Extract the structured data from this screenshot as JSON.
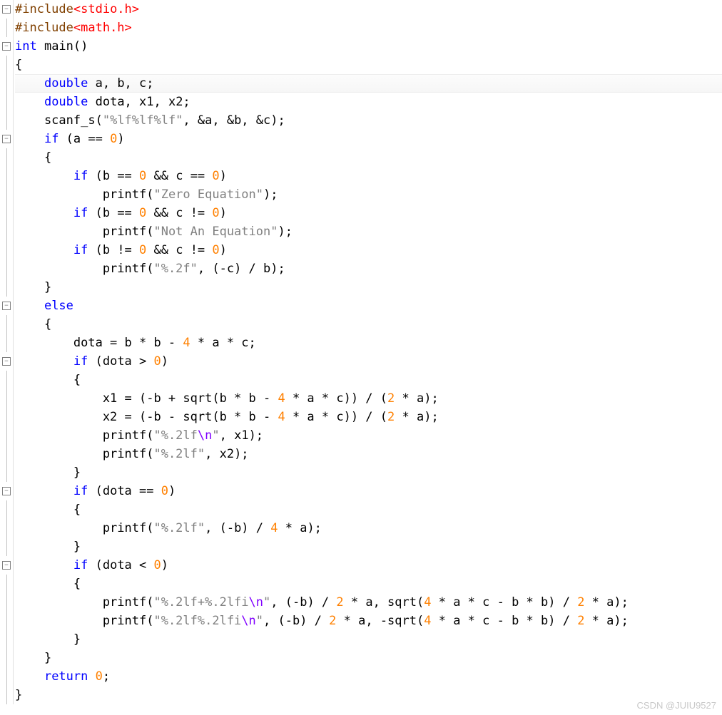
{
  "watermark": "CSDN @JUIU9527",
  "gutter": {
    "fold_minus": "⊟",
    "fold_line": "│"
  },
  "lines": [
    {
      "g": "box",
      "tokens": [
        {
          "t": "#include",
          "c": "preproc"
        },
        {
          "t": "<stdio.h>",
          "c": "angled"
        }
      ]
    },
    {
      "g": "line",
      "tokens": [
        {
          "t": "#include",
          "c": "preproc"
        },
        {
          "t": "<math.h>",
          "c": "angled"
        }
      ]
    },
    {
      "g": "box",
      "tokens": [
        {
          "t": "int",
          "c": "kw-blue"
        },
        {
          "t": " main()",
          "c": "func"
        }
      ]
    },
    {
      "g": "line",
      "tokens": [
        {
          "t": "{",
          "c": "func"
        }
      ]
    },
    {
      "g": "line",
      "hl": true,
      "tokens": [
        {
          "t": "    ",
          "c": ""
        },
        {
          "t": "double",
          "c": "kw-blue"
        },
        {
          "t": " a, b, c;",
          "c": "func"
        }
      ]
    },
    {
      "g": "line",
      "tokens": [
        {
          "t": "    ",
          "c": ""
        },
        {
          "t": "double",
          "c": "kw-blue"
        },
        {
          "t": " dota, x1, x2;",
          "c": "func"
        }
      ]
    },
    {
      "g": "line",
      "tokens": [
        {
          "t": "    scanf_s(",
          "c": "func"
        },
        {
          "t": "\"%lf%lf%lf\"",
          "c": "str"
        },
        {
          "t": ", &a, &b, &c);",
          "c": "func"
        }
      ]
    },
    {
      "g": "box",
      "tokens": [
        {
          "t": "    ",
          "c": ""
        },
        {
          "t": "if",
          "c": "kw-blue"
        },
        {
          "t": " (a == ",
          "c": "func"
        },
        {
          "t": "0",
          "c": "num"
        },
        {
          "t": ")",
          "c": "func"
        }
      ]
    },
    {
      "g": "line",
      "tokens": [
        {
          "t": "    {",
          "c": "func"
        }
      ]
    },
    {
      "g": "line",
      "tokens": [
        {
          "t": "        ",
          "c": ""
        },
        {
          "t": "if",
          "c": "kw-blue"
        },
        {
          "t": " (b == ",
          "c": "func"
        },
        {
          "t": "0",
          "c": "num"
        },
        {
          "t": " && c == ",
          "c": "func"
        },
        {
          "t": "0",
          "c": "num"
        },
        {
          "t": ")",
          "c": "func"
        }
      ]
    },
    {
      "g": "line",
      "tokens": [
        {
          "t": "            printf(",
          "c": "func"
        },
        {
          "t": "\"Zero Equation\"",
          "c": "str"
        },
        {
          "t": ");",
          "c": "func"
        }
      ]
    },
    {
      "g": "line",
      "tokens": [
        {
          "t": "        ",
          "c": ""
        },
        {
          "t": "if",
          "c": "kw-blue"
        },
        {
          "t": " (b == ",
          "c": "func"
        },
        {
          "t": "0",
          "c": "num"
        },
        {
          "t": " && c != ",
          "c": "func"
        },
        {
          "t": "0",
          "c": "num"
        },
        {
          "t": ")",
          "c": "func"
        }
      ]
    },
    {
      "g": "line",
      "tokens": [
        {
          "t": "            printf(",
          "c": "func"
        },
        {
          "t": "\"Not An Equation\"",
          "c": "str"
        },
        {
          "t": ");",
          "c": "func"
        }
      ]
    },
    {
      "g": "line",
      "tokens": [
        {
          "t": "        ",
          "c": ""
        },
        {
          "t": "if",
          "c": "kw-blue"
        },
        {
          "t": " (b != ",
          "c": "func"
        },
        {
          "t": "0",
          "c": "num"
        },
        {
          "t": " && c != ",
          "c": "func"
        },
        {
          "t": "0",
          "c": "num"
        },
        {
          "t": ")",
          "c": "func"
        }
      ]
    },
    {
      "g": "line",
      "tokens": [
        {
          "t": "            printf(",
          "c": "func"
        },
        {
          "t": "\"%.2f\"",
          "c": "str"
        },
        {
          "t": ", (-c) / b);",
          "c": "func"
        }
      ]
    },
    {
      "g": "line",
      "tokens": [
        {
          "t": "    }",
          "c": "func"
        }
      ]
    },
    {
      "g": "box",
      "tokens": [
        {
          "t": "    ",
          "c": ""
        },
        {
          "t": "else",
          "c": "kw-blue"
        }
      ]
    },
    {
      "g": "line",
      "tokens": [
        {
          "t": "    {",
          "c": "func"
        }
      ]
    },
    {
      "g": "line",
      "tokens": [
        {
          "t": "        dota = b * b - ",
          "c": "func"
        },
        {
          "t": "4",
          "c": "num"
        },
        {
          "t": " * a * c;",
          "c": "func"
        }
      ]
    },
    {
      "g": "box",
      "tokens": [
        {
          "t": "        ",
          "c": ""
        },
        {
          "t": "if",
          "c": "kw-blue"
        },
        {
          "t": " (dota > ",
          "c": "func"
        },
        {
          "t": "0",
          "c": "num"
        },
        {
          "t": ")",
          "c": "func"
        }
      ]
    },
    {
      "g": "line",
      "tokens": [
        {
          "t": "        {",
          "c": "func"
        }
      ]
    },
    {
      "g": "line",
      "tokens": [
        {
          "t": "            x1 = (-b + sqrt(b * b - ",
          "c": "func"
        },
        {
          "t": "4",
          "c": "num"
        },
        {
          "t": " * a * c)) / (",
          "c": "func"
        },
        {
          "t": "2",
          "c": "num"
        },
        {
          "t": " * a);",
          "c": "func"
        }
      ]
    },
    {
      "g": "line",
      "tokens": [
        {
          "t": "            x2 = (-b - sqrt(b * b - ",
          "c": "func"
        },
        {
          "t": "4",
          "c": "num"
        },
        {
          "t": " * a * c)) / (",
          "c": "func"
        },
        {
          "t": "2",
          "c": "num"
        },
        {
          "t": " * a);",
          "c": "func"
        }
      ]
    },
    {
      "g": "line",
      "tokens": [
        {
          "t": "            printf(",
          "c": "func"
        },
        {
          "t": "\"%.2lf",
          "c": "str"
        },
        {
          "t": "\\n",
          "c": "kw-purple"
        },
        {
          "t": "\"",
          "c": "str"
        },
        {
          "t": ", x1);",
          "c": "func"
        }
      ]
    },
    {
      "g": "line",
      "tokens": [
        {
          "t": "            printf(",
          "c": "func"
        },
        {
          "t": "\"%.2lf\"",
          "c": "str"
        },
        {
          "t": ", x2);",
          "c": "func"
        }
      ]
    },
    {
      "g": "line",
      "tokens": [
        {
          "t": "        }",
          "c": "func"
        }
      ]
    },
    {
      "g": "box",
      "tokens": [
        {
          "t": "        ",
          "c": ""
        },
        {
          "t": "if",
          "c": "kw-blue"
        },
        {
          "t": " (dota == ",
          "c": "func"
        },
        {
          "t": "0",
          "c": "num"
        },
        {
          "t": ")",
          "c": "func"
        }
      ]
    },
    {
      "g": "line",
      "tokens": [
        {
          "t": "        {",
          "c": "func"
        }
      ]
    },
    {
      "g": "line",
      "tokens": [
        {
          "t": "            printf(",
          "c": "func"
        },
        {
          "t": "\"%.2lf\"",
          "c": "str"
        },
        {
          "t": ", (-b) / ",
          "c": "func"
        },
        {
          "t": "4",
          "c": "num"
        },
        {
          "t": " * a);",
          "c": "func"
        }
      ]
    },
    {
      "g": "line",
      "tokens": [
        {
          "t": "        }",
          "c": "func"
        }
      ]
    },
    {
      "g": "box",
      "tokens": [
        {
          "t": "        ",
          "c": ""
        },
        {
          "t": "if",
          "c": "kw-blue"
        },
        {
          "t": " (dota < ",
          "c": "func"
        },
        {
          "t": "0",
          "c": "num"
        },
        {
          "t": ")",
          "c": "func"
        }
      ]
    },
    {
      "g": "line",
      "tokens": [
        {
          "t": "        {",
          "c": "func"
        }
      ]
    },
    {
      "g": "line",
      "tokens": [
        {
          "t": "            printf(",
          "c": "func"
        },
        {
          "t": "\"%.2lf+%.2lfi",
          "c": "str"
        },
        {
          "t": "\\n",
          "c": "kw-purple"
        },
        {
          "t": "\"",
          "c": "str"
        },
        {
          "t": ", (-b) / ",
          "c": "func"
        },
        {
          "t": "2",
          "c": "num"
        },
        {
          "t": " * a, sqrt(",
          "c": "func"
        },
        {
          "t": "4",
          "c": "num"
        },
        {
          "t": " * a * c - b * b) / ",
          "c": "func"
        },
        {
          "t": "2",
          "c": "num"
        },
        {
          "t": " * a);",
          "c": "func"
        }
      ]
    },
    {
      "g": "line",
      "tokens": [
        {
          "t": "            printf(",
          "c": "func"
        },
        {
          "t": "\"%.2lf%.2lfi",
          "c": "str"
        },
        {
          "t": "\\n",
          "c": "kw-purple"
        },
        {
          "t": "\"",
          "c": "str"
        },
        {
          "t": ", (-b) / ",
          "c": "func"
        },
        {
          "t": "2",
          "c": "num"
        },
        {
          "t": " * a, -sqrt(",
          "c": "func"
        },
        {
          "t": "4",
          "c": "num"
        },
        {
          "t": " * a * c - b * b) / ",
          "c": "func"
        },
        {
          "t": "2",
          "c": "num"
        },
        {
          "t": " * a);",
          "c": "func"
        }
      ]
    },
    {
      "g": "line",
      "tokens": [
        {
          "t": "        }",
          "c": "func"
        }
      ]
    },
    {
      "g": "line",
      "tokens": [
        {
          "t": "    }",
          "c": "func"
        }
      ]
    },
    {
      "g": "line",
      "tokens": [
        {
          "t": "    ",
          "c": ""
        },
        {
          "t": "return",
          "c": "kw-blue"
        },
        {
          "t": " ",
          "c": ""
        },
        {
          "t": "0",
          "c": "num"
        },
        {
          "t": ";",
          "c": "func"
        }
      ]
    },
    {
      "g": "line",
      "tokens": [
        {
          "t": "}",
          "c": "func"
        }
      ]
    }
  ]
}
